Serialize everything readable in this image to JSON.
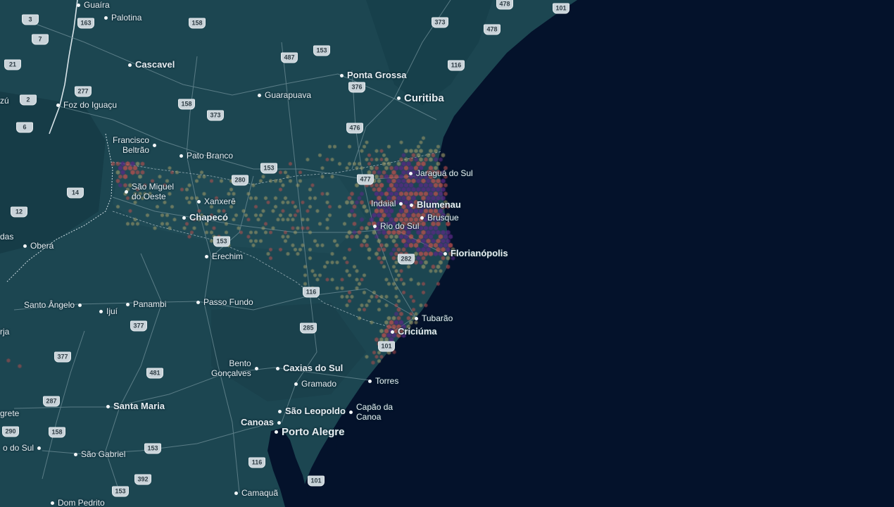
{
  "map": {
    "colors": {
      "ocean": "#04122b",
      "land": "#1c4651",
      "land_dark": "#133640",
      "roads": "#6f8f98",
      "hex_low": "#a9a06a",
      "hex_mid": "#c0504d",
      "hex_high": "#5b2a86",
      "label": "#e8eef2"
    },
    "cities": [
      {
        "name": "Guaíra",
        "tier": "minor"
      },
      {
        "name": "Palotina",
        "tier": "minor"
      },
      {
        "name": "Cascavel",
        "tier": "mid"
      },
      {
        "name": "Ponta Grossa",
        "tier": "mid"
      },
      {
        "name": "Curitiba",
        "tier": "major"
      },
      {
        "name": "Guarapuava",
        "tier": "minor"
      },
      {
        "name": "Foz do Iguaçu",
        "tier": "minor"
      },
      {
        "name": "zú",
        "tier": "minor"
      },
      {
        "name": "Francisco\nBeltrão",
        "tier": "minor"
      },
      {
        "name": "Pato Branco",
        "tier": "minor"
      },
      {
        "name": "Jaraguá do Sul",
        "tier": "minor"
      },
      {
        "name": "São Miguel\ndo Oeste",
        "tier": "minor"
      },
      {
        "name": "Xanxerê",
        "tier": "minor"
      },
      {
        "name": "Indaial",
        "tier": "minor"
      },
      {
        "name": "Blumenau",
        "tier": "mid"
      },
      {
        "name": "Brusque",
        "tier": "minor"
      },
      {
        "name": "Chapecó",
        "tier": "mid"
      },
      {
        "name": "Rio do Sul",
        "tier": "minor"
      },
      {
        "name": "das",
        "tier": "minor"
      },
      {
        "name": "Oberá",
        "tier": "minor"
      },
      {
        "name": "Florianópolis",
        "tier": "mid"
      },
      {
        "name": "Erechim",
        "tier": "minor"
      },
      {
        "name": "Santo Ângelo",
        "tier": "minor"
      },
      {
        "name": "Ijuí",
        "tier": "minor"
      },
      {
        "name": "Panambi",
        "tier": "minor"
      },
      {
        "name": "Passo Fundo",
        "tier": "minor"
      },
      {
        "name": "Tubarão",
        "tier": "minor"
      },
      {
        "name": "Criciúma",
        "tier": "mid"
      },
      {
        "name": "rja",
        "tier": "minor"
      },
      {
        "name": "Bento\nGonçalves",
        "tier": "minor"
      },
      {
        "name": "Caxias do Sul",
        "tier": "mid"
      },
      {
        "name": "Gramado",
        "tier": "minor"
      },
      {
        "name": "Torres",
        "tier": "minor"
      },
      {
        "name": "Santa Maria",
        "tier": "mid"
      },
      {
        "name": "São Leopoldo",
        "tier": "mid"
      },
      {
        "name": "Capão da\nCanoa",
        "tier": "minor"
      },
      {
        "name": "grete",
        "tier": "minor"
      },
      {
        "name": "Canoas",
        "tier": "mid"
      },
      {
        "name": "Porto Alegre",
        "tier": "major"
      },
      {
        "name": "o do Sul",
        "tier": "minor"
      },
      {
        "name": "São Gabriel",
        "tier": "minor"
      },
      {
        "name": "Camaquã",
        "tier": "minor"
      },
      {
        "name": "Dom Pedrito",
        "tier": "minor"
      }
    ],
    "shields": [
      "478",
      "101",
      "3",
      "163",
      "158",
      "373",
      "478",
      "7",
      "487",
      "153",
      "116",
      "21",
      "277",
      "376",
      "2",
      "158",
      "373",
      "6",
      "476",
      "153",
      "280",
      "477",
      "14",
      "12",
      "153",
      "282",
      "116",
      "377",
      "285",
      "101",
      "377",
      "481",
      "287",
      "290",
      "158",
      "153",
      "116",
      "392",
      "153",
      "101"
    ]
  }
}
